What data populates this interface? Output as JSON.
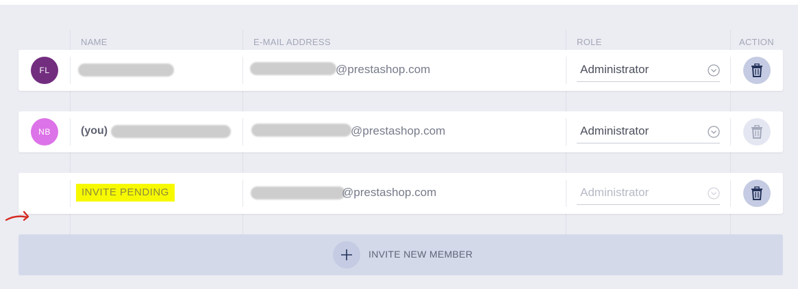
{
  "table": {
    "headers": {
      "name": "NAME",
      "email": "E-MAIL ADDRESS",
      "role": "ROLE",
      "action": "ACTION"
    },
    "members": [
      {
        "initials": "FL",
        "avatar_color": "#722d7f",
        "name_prefix": "",
        "email_domain": "@prestashop.com",
        "role": "Administrator",
        "role_disabled": false,
        "delete_enabled": true,
        "status": ""
      },
      {
        "initials": "NB",
        "avatar_color": "#dd73e8",
        "name_prefix": "(you)",
        "email_domain": "@prestashop.com",
        "role": "Administrator",
        "role_disabled": false,
        "delete_enabled": false,
        "status": ""
      },
      {
        "initials": "",
        "avatar_color": "",
        "name_prefix": "",
        "email_domain": "@prestashop.com",
        "role": "Administrator",
        "role_disabled": true,
        "delete_enabled": true,
        "status": "INVITE PENDING",
        "status_highlight": "#f6f900"
      }
    ]
  },
  "invite": {
    "label": "INVITE NEW MEMBER"
  },
  "icons": {
    "delete": "trash-icon",
    "role_dropdown": "chevron-down-circle-icon",
    "invite": "plus-icon",
    "annotation": "red-arrow-annotation"
  },
  "colors": {
    "panel_bg": "#ecedf3",
    "button_bg": "#c4cbe2",
    "icon_dark": "#25335a",
    "annotation_red": "#d42a22"
  }
}
